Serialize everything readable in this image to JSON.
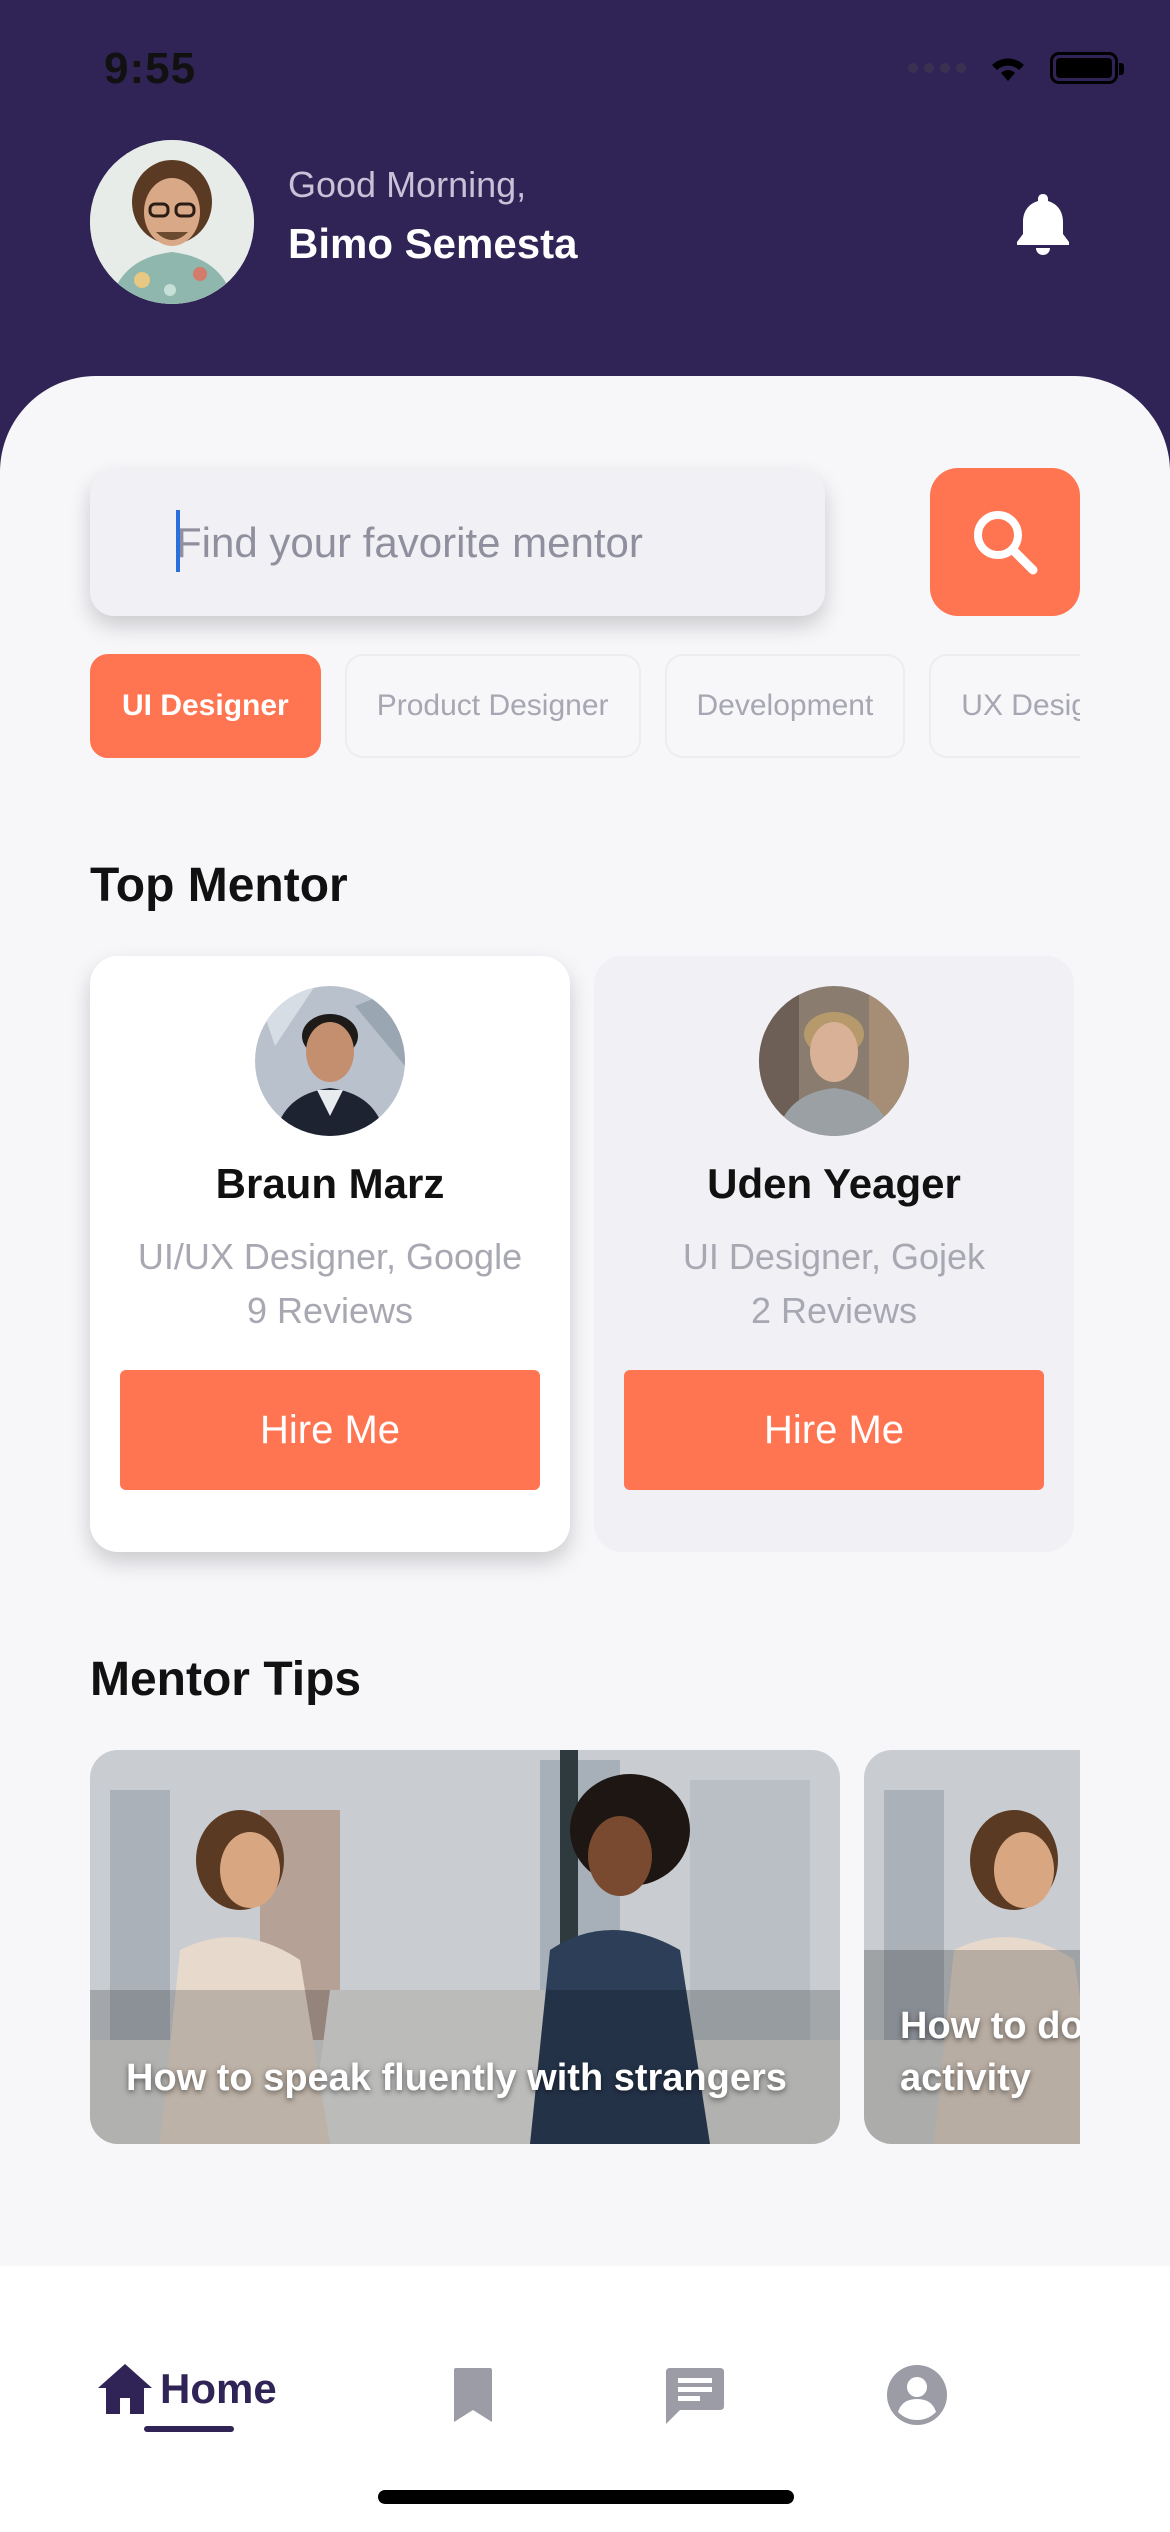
{
  "status_bar": {
    "time": "9:55"
  },
  "header": {
    "greeting": "Good Morning,",
    "user_name": "Bimo Semesta"
  },
  "search": {
    "placeholder": "Find your favorite mentor"
  },
  "categories": [
    {
      "label": "UI Designer",
      "active": true
    },
    {
      "label": "Product Designer",
      "active": false
    },
    {
      "label": "Development",
      "active": false
    },
    {
      "label": "UX Designer",
      "active": false
    }
  ],
  "top_mentor": {
    "title": "Top Mentor",
    "mentors": [
      {
        "name": "Braun Marz",
        "role": "UI/UX Designer, Google",
        "reviews": "9 Reviews",
        "button": "Hire Me"
      },
      {
        "name": "Uden Yeager",
        "role": "UI Designer, Gojek",
        "reviews": "2 Reviews",
        "button": "Hire Me"
      }
    ]
  },
  "mentor_tips": {
    "title": "Mentor Tips",
    "tips": [
      {
        "title": "How to speak fluently with strangers"
      },
      {
        "title": "How to do activity"
      }
    ]
  },
  "tab_bar": {
    "home_label": "Home",
    "items": [
      "home-icon",
      "bookmark-icon",
      "chat-icon",
      "profile-icon"
    ],
    "active": "Home"
  },
  "colors": {
    "brand_dark": "#2f2455",
    "accent": "#ff7451",
    "background": "#f7f7fa"
  }
}
